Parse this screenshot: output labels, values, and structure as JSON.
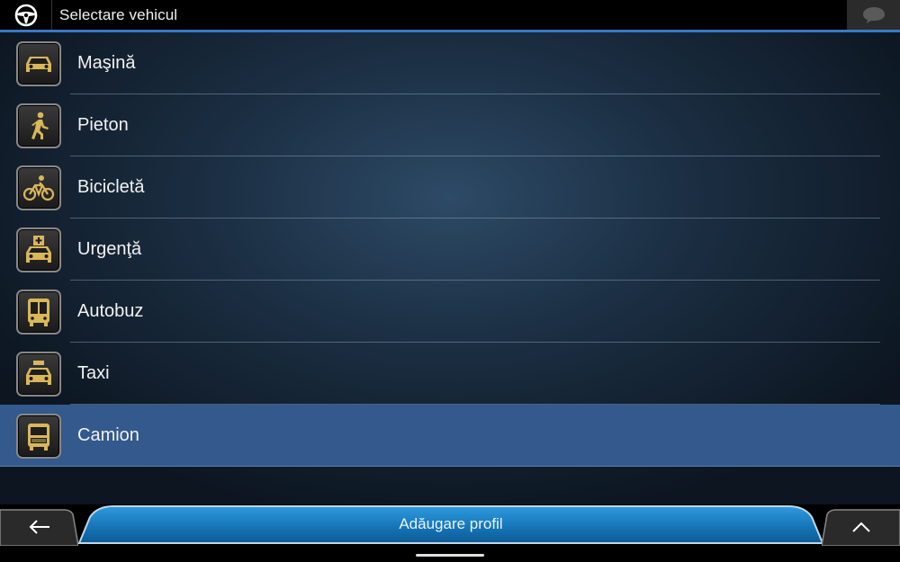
{
  "header": {
    "title": "Selectare vehicul",
    "nav_icon": "steering-wheel-icon",
    "chat_icon": "speech-bubble-icon"
  },
  "vehicles": [
    {
      "label": "Maşină",
      "icon": "car-icon",
      "selected": false
    },
    {
      "label": "Pieton",
      "icon": "pedestrian-icon",
      "selected": false
    },
    {
      "label": "Bicicletă",
      "icon": "bicycle-icon",
      "selected": false
    },
    {
      "label": "Urgenţă",
      "icon": "ambulance-icon",
      "selected": false
    },
    {
      "label": "Autobuz",
      "icon": "bus-icon",
      "selected": false
    },
    {
      "label": "Taxi",
      "icon": "taxi-icon",
      "selected": false
    },
    {
      "label": "Camion",
      "icon": "truck-icon",
      "selected": true
    }
  ],
  "footer": {
    "add_profile_label": "Adăugare profil",
    "back_icon": "back-arrow-icon",
    "up_icon": "chevron-up-icon"
  },
  "colors": {
    "accent": "#3a78c4",
    "selected_row": "#33598d",
    "icon_gold": "#d9b75a",
    "button_blue": "#1a7fc4"
  }
}
